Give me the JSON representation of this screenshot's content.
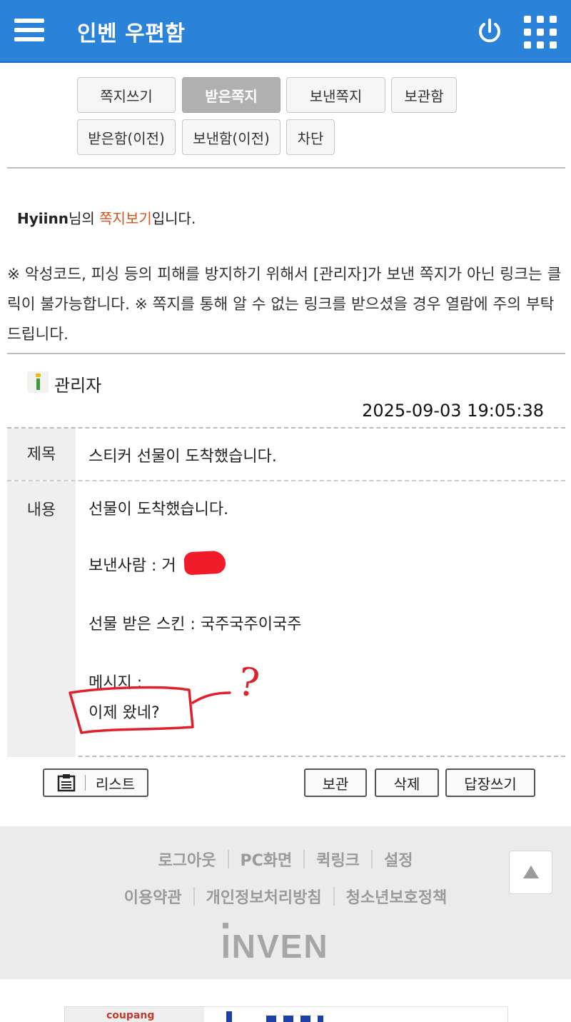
{
  "header": {
    "title": "인벤 우편함"
  },
  "tabs": {
    "write": "쪽지쓰기",
    "received": "받은쪽지",
    "sent": "보낸쪽지",
    "storage": "보관함",
    "received_old": "받은함(이전)",
    "sent_old": "보낸함(이전)",
    "block": "차단"
  },
  "intro": {
    "user": "Hyiinn",
    "suffix1": "님의 ",
    "highlight": "쪽지보기",
    "suffix2": "입니다."
  },
  "notice": "※ 악성코드, 피싱 등의 피해를 방지하기 위해서 [관리자]가 보낸 쪽지가 아닌 링크는 클릭이 불가능합니다. ※ 쪽지를 통해 알 수 없는 링크를 받으셨을 경우 열람에 주의 부탁 드립니다.",
  "message": {
    "sender": "관리자",
    "date": "2025-09-03 19:05:38",
    "subject_label": "제목",
    "subject": "스티커 선물이 도착했습니다.",
    "content_label": "내용",
    "line1": "선물이 도착했습니다.",
    "line2": "보낸사람 : 거",
    "line3": "선물 받은 스킨 : 국주국주이국주",
    "line4": "메시지 :",
    "line5": "이제 왔네?",
    "annotation_mark": "?"
  },
  "buttons": {
    "list": "리스트",
    "save": "보관",
    "delete": "삭제",
    "reply": "답장쓰기"
  },
  "footer": {
    "row1": [
      "로그아웃",
      "PC화면",
      "퀵링크",
      "설정"
    ],
    "row2": [
      "이용약관",
      "개인정보처리방침",
      "청소년보호정책"
    ],
    "logo": "INVEN"
  },
  "ad": {
    "brand": "coupang"
  },
  "colors": {
    "header": "#2a83d8",
    "highlight": "#d9531e",
    "annotation": "#e0202c"
  }
}
